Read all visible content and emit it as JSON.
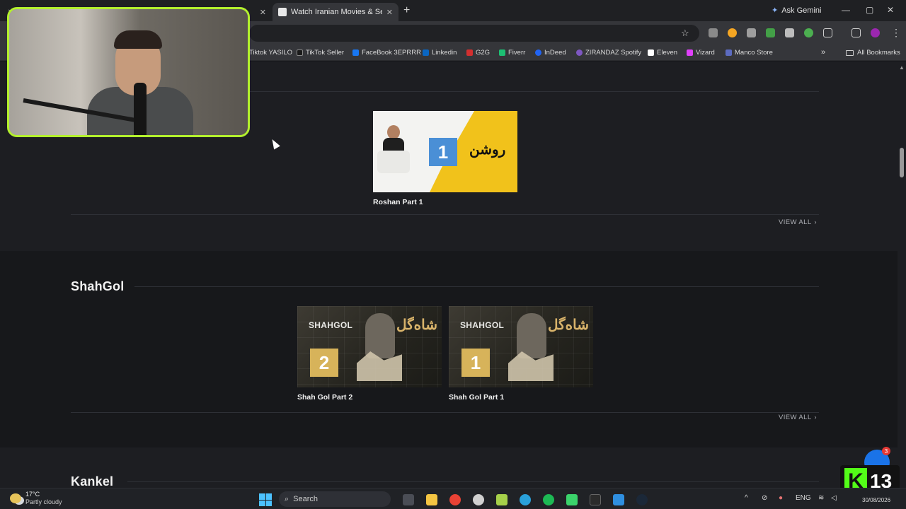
{
  "browser": {
    "tabs": [
      {
        "title": ""
      },
      {
        "title": "Watch Iranian Movies & Serials"
      }
    ],
    "ask_gemini": "Ask Gemini",
    "bookmarks": [
      {
        "label": "Tiktok YASILO",
        "color": "#1a1a1a"
      },
      {
        "label": "TikTok Seller",
        "color": "#1a1a1a"
      },
      {
        "label": "FaceBook 3EPRRR",
        "color": "#1877f2"
      },
      {
        "label": "Linkedin",
        "color": "#0a66c2"
      },
      {
        "label": "G2G",
        "color": "#d32f2f"
      },
      {
        "label": "Fiverr",
        "color": "#1dbf73"
      },
      {
        "label": "InDeed",
        "color": "#2164f3"
      },
      {
        "label": "ZIRANDAZ Spotify",
        "color": "#7e57c2"
      },
      {
        "label": "Eleven",
        "color": "#ffffff"
      },
      {
        "label": "Vizard",
        "color": "#e040fb"
      },
      {
        "label": "Manco Store",
        "color": "#5c6bc0"
      }
    ],
    "all_bookmarks": "All Bookmarks"
  },
  "sections": {
    "roshan": {
      "cards": [
        {
          "title": "Roshan Part 1",
          "number": "1",
          "logo": "روشن"
        }
      ],
      "view_all": "VIEW ALL"
    },
    "shahgol": {
      "heading": "ShahGol",
      "cards": [
        {
          "title": "Shah Gol Part 2",
          "number": "2",
          "brand": "SHAHGOL",
          "logo": "شاه‌گل"
        },
        {
          "title": "Shah Gol Part 1",
          "number": "1",
          "brand": "SHAHGOL",
          "logo": "شاه‌گل"
        }
      ],
      "view_all": "VIEW ALL"
    },
    "kankel": {
      "heading": "Kankel"
    }
  },
  "notification": {
    "count": "3"
  },
  "stream_overlay": {
    "badge_letter": "K",
    "badge_number": "13"
  },
  "taskbar": {
    "weather_temp": "17°C",
    "weather_cond": "Partly cloudy",
    "search_placeholder": "Search",
    "lang": "ENG",
    "date": "30/08/2026"
  },
  "colors": {
    "accent_green": "#b3f02d",
    "kick_green": "#53fc18",
    "page_bg": "#1d1e22",
    "alt_bg": "#17181b"
  }
}
